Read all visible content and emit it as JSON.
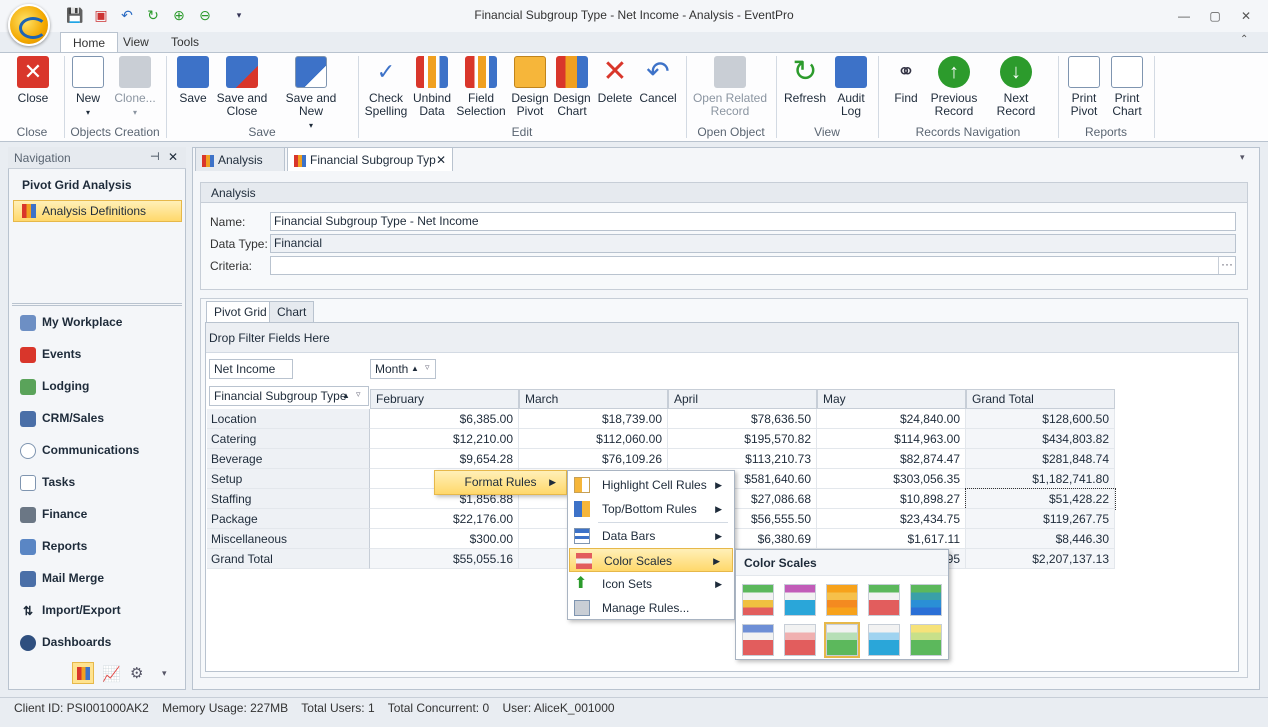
{
  "window": {
    "title": "Financial Subgroup Type - Net Income - Analysis - EventPro"
  },
  "ribbon": {
    "tabs": [
      "Home",
      "View",
      "Tools"
    ],
    "buttons": {
      "close": "Close",
      "new": "New",
      "clone": "Clone...",
      "save": "Save",
      "save_close": [
        "Save and",
        "Close"
      ],
      "save_new": "Save and New",
      "check_spelling": [
        "Check",
        "Spelling"
      ],
      "unbind_data": [
        "Unbind",
        "Data"
      ],
      "field_selection": [
        "Field",
        "Selection"
      ],
      "design_pivot": [
        "Design",
        "Pivot"
      ],
      "design_chart": [
        "Design",
        "Chart"
      ],
      "delete": "Delete",
      "cancel": "Cancel",
      "open_related": [
        "Open Related",
        "Record"
      ],
      "refresh": "Refresh",
      "audit_log": [
        "Audit",
        "Log"
      ],
      "find": "Find",
      "previous_record": [
        "Previous",
        "Record"
      ],
      "next_record": "Next Record",
      "print_pivot": [
        "Print",
        "Pivot"
      ],
      "print_chart": [
        "Print",
        "Chart"
      ]
    },
    "groups": {
      "close": "Close",
      "objects_creation": "Objects Creation",
      "save": "Save",
      "edit": "Edit",
      "open_object": "Open Object",
      "view": "View",
      "records_navigation": "Records Navigation",
      "reports": "Reports"
    }
  },
  "navigation": {
    "header": "Navigation",
    "section_title": "Pivot Grid Analysis",
    "selected_item": "Analysis Definitions",
    "items": [
      "My Workplace",
      "Events",
      "Lodging",
      "CRM/Sales",
      "Communications",
      "Tasks",
      "Finance",
      "Reports",
      "Mail Merge",
      "Import/Export",
      "Dashboards"
    ]
  },
  "doc_tabs": [
    "Analysis",
    "Financial Subgroup Typ"
  ],
  "analysis": {
    "group_title": "Analysis",
    "name_label": "Name:",
    "name_value": "Financial Subgroup Type - Net Income",
    "datatype_label": "Data Type:",
    "datatype_value": "Financial",
    "criteria_label": "Criteria:",
    "criteria_value": "",
    "criteria_ellipsis": "···"
  },
  "pivot": {
    "tabs": [
      "Pivot Grid",
      "Chart"
    ],
    "drop_filter": "Drop Filter Fields Here",
    "data_field": "Net Income",
    "column_field": "Month",
    "row_field": "Financial Subgroup Type",
    "columns": [
      "February",
      "March",
      "April",
      "May",
      "Grand Total"
    ],
    "rows": [
      {
        "label": "Location",
        "values": [
          "$6,385.00",
          "$18,739.00",
          "$78,636.50",
          "$24,840.00",
          "$128,600.50"
        ]
      },
      {
        "label": "Catering",
        "values": [
          "$12,210.00",
          "$112,060.00",
          "$195,570.82",
          "$114,963.00",
          "$434,803.82"
        ]
      },
      {
        "label": "Beverage",
        "values": [
          "$9,654.28",
          "$76,109.26",
          "$113,210.73",
          "$82,874.47",
          "$281,848.74"
        ]
      },
      {
        "label": "Setup",
        "values": [
          "",
          "",
          "$581,640.60",
          "$303,056.35",
          "$1,182,741.80"
        ]
      },
      {
        "label": "Staffing",
        "values": [
          "$1,856.88",
          "",
          "$27,086.68",
          "$10,898.27",
          "$51,428.22"
        ]
      },
      {
        "label": "Package",
        "values": [
          "$22,176.00",
          "",
          "$56,555.50",
          "$23,434.75",
          "$119,267.75"
        ]
      },
      {
        "label": "Miscellaneous",
        "values": [
          "$300.00",
          "",
          "$6,380.69",
          "$1,617.11",
          "$8,446.30"
        ]
      },
      {
        "label": "Grand Total",
        "values": [
          "$55,055.16",
          "",
          "",
          "95",
          "$2,207,137.13"
        ]
      }
    ]
  },
  "context_menu": {
    "format_rules": "Format Rules",
    "items": [
      "Highlight Cell Rules",
      "Top/Bottom Rules",
      "Data Bars",
      "Color Scales",
      "Icon Sets",
      "Manage Rules..."
    ],
    "color_scales_title": "Color Scales",
    "scales": [
      [
        "#5cb85c",
        "#f2f2f2",
        "#f0c040",
        "#e25d5d"
      ],
      [
        "#c25cb8",
        "#f2f2f2",
        "#2aa6d9",
        "#2aa6d9"
      ],
      [
        "#f7a21b",
        "#f6c04a",
        "#f48a20",
        "#f7a21b"
      ],
      [
        "#5cb85c",
        "#f2f2f2",
        "#e25d5d",
        "#e25d5d"
      ],
      [
        "#5cb85c",
        "#3aa0a8",
        "#2a8fd6",
        "#2a6fd6"
      ],
      [
        "#6e8fd6",
        "#f2f2f2",
        "#e25d5d",
        "#e25d5d"
      ],
      [
        "#f2f2f2",
        "#f0b0b0",
        "#e25d5d",
        "#e25d5d"
      ],
      [
        "#f2f2f2",
        "#b6dfb6",
        "#5cb85c",
        "#5cb85c"
      ],
      [
        "#f2f2f2",
        "#9fd3f0",
        "#2aa6d9",
        "#2aa6d9"
      ],
      [
        "#f6e27a",
        "#c8e08a",
        "#5cb85c",
        "#5cb85c"
      ]
    ]
  },
  "status": {
    "client_id": "Client ID: PSI001000AK2",
    "memory": "Memory Usage: 227MB",
    "total_users": "Total Users: 1",
    "total_concurrent": "Total Concurrent: 0",
    "user": "User: AliceK_001000"
  }
}
